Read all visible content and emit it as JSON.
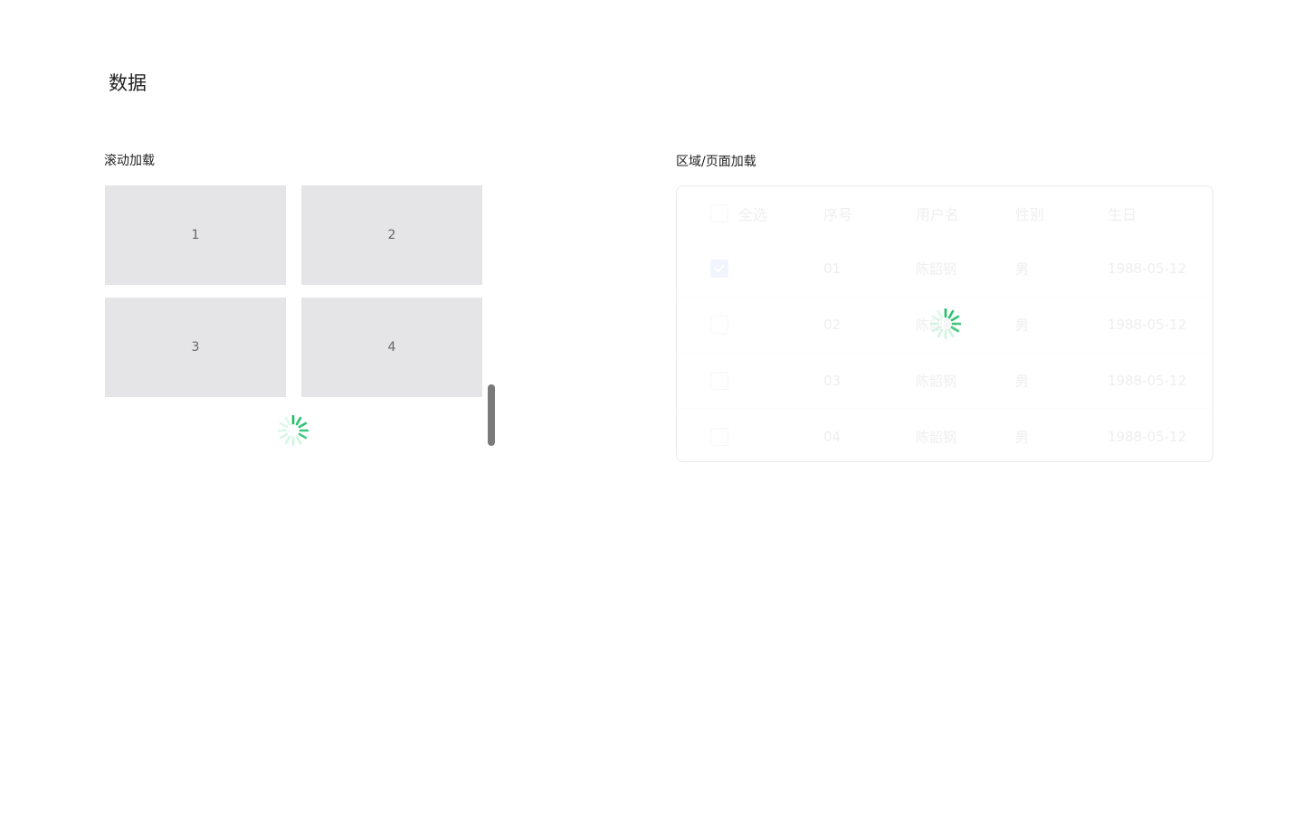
{
  "page": {
    "title": "数据"
  },
  "scroll_section": {
    "title": "滚动加载",
    "cards": [
      "1",
      "2",
      "3",
      "4"
    ]
  },
  "region_section": {
    "title": "区域/页面加载",
    "table": {
      "headers": {
        "select_all": "全选",
        "num": "序号",
        "user": "用户名",
        "gender": "性别",
        "birth": "生日"
      },
      "rows": [
        {
          "checked": true,
          "num": "01",
          "user": "陈韶钢",
          "gender": "男",
          "birth": "1988-05-12"
        },
        {
          "checked": false,
          "num": "02",
          "user": "陈韶钢",
          "gender": "男",
          "birth": "1988-05-12"
        },
        {
          "checked": false,
          "num": "03",
          "user": "陈韶钢",
          "gender": "男",
          "birth": "1988-05-12"
        },
        {
          "checked": false,
          "num": "04",
          "user": "陈韶钢",
          "gender": "男",
          "birth": "1988-05-12"
        }
      ]
    }
  },
  "colors": {
    "spinner_dark": "#1fbf68",
    "spinner_light": "#bff3d6",
    "card_bg": "#e5e5e7",
    "checkbox_checked": "#4e8cf7"
  }
}
